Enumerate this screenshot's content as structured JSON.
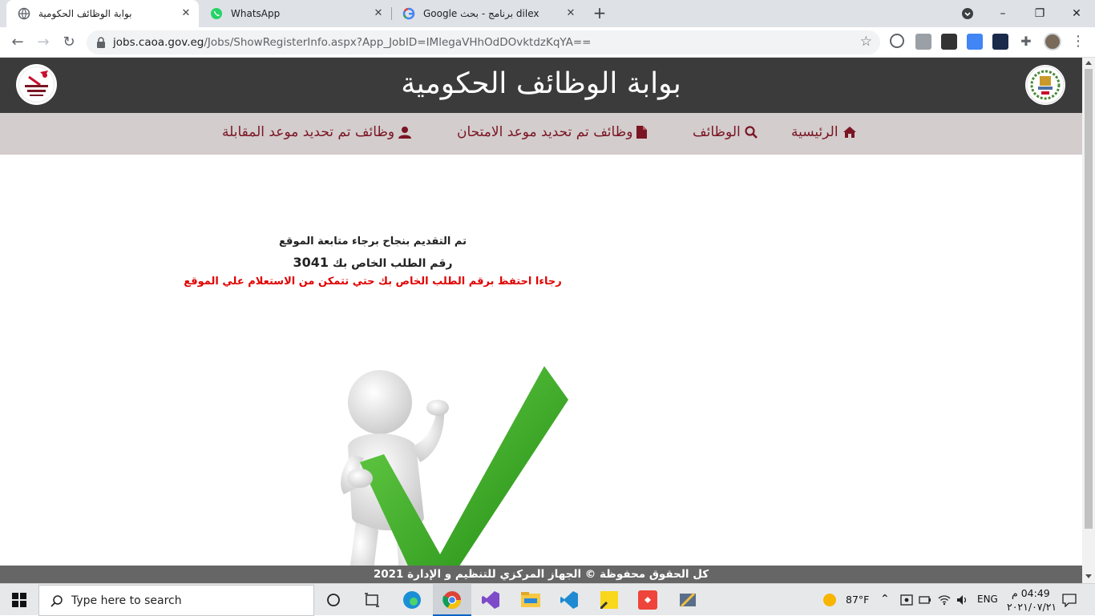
{
  "browser": {
    "tabs": [
      {
        "title": "بوابة الوظائف الحكومية"
      },
      {
        "title": "WhatsApp"
      },
      {
        "title": "dilex برنامج - بحث Google"
      }
    ],
    "address": {
      "host": "jobs.caoa.gov.eg",
      "path": "/Jobs/ShowRegisterInfo.aspx?App_JobID=IMlegaVHhOdDOvktdzKqYA=="
    }
  },
  "site": {
    "title": "بوابة الوظائف الحكومية",
    "logo_left_text": "بوابة الوظائف الحكومية",
    "nav": [
      {
        "label": "الرئيسية",
        "icon": "home-icon"
      },
      {
        "label": "الوظائف",
        "icon": "search-icon"
      },
      {
        "label": "وظائف تم تحديد موعد الامتحان",
        "icon": "file-icon"
      },
      {
        "label": "وظائف تم تحديد موعد المقابلة",
        "icon": "user-icon"
      }
    ]
  },
  "message": {
    "success": "تم التقديم بنجاح برجاء متابعة الموقع",
    "request_label": "رقم الطلب الخاص بك",
    "request_number": "3041",
    "warning": "رجاءا احتفظ برقم الطلب الخاص بك حتي تتمكن من الاستعلام علي الموقع"
  },
  "footer": {
    "text": "كل الحقوق محفوظة © الجهاز المركزي للتنظيم و الإدارة 2021"
  },
  "taskbar": {
    "search_placeholder": "Type here to search",
    "weather": "87°F",
    "language": "ENG",
    "time": "04:49 م",
    "date": "٢٠٢١/٠٧/٢١"
  },
  "colors": {
    "header": "#3b3b3b",
    "nav": "#d3cdcd",
    "nav_text": "#7a1524",
    "warning": "#e00000",
    "check": "#2e9e1e"
  }
}
